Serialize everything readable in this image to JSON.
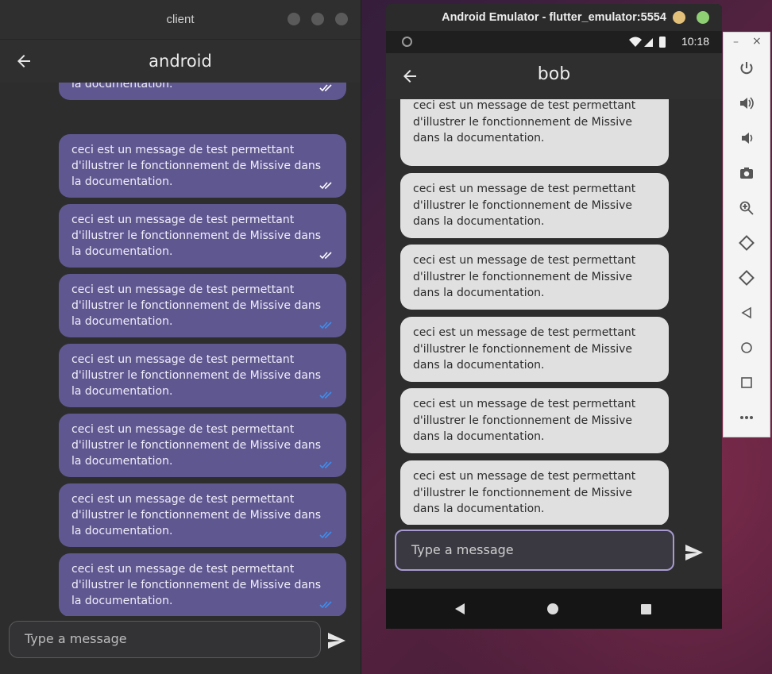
{
  "left_window": {
    "title": "client",
    "appbar_title": "android",
    "messages": [
      {
        "text": "d'illustrer le fonctionnement de Missive dans la documentation.",
        "status": "read"
      },
      {
        "text": "ceci est un message de test permettant d'illustrer le fonctionnement de Missive dans la documentation.",
        "status": "read"
      },
      {
        "text": "ceci est un message de test permettant d'illustrer le fonctionnement de Missive dans la documentation.",
        "status": "read"
      },
      {
        "text": "ceci est un message de test permettant d'illustrer le fonctionnement de Missive dans la documentation.",
        "status": "delivered"
      },
      {
        "text": "ceci est un message de test permettant d'illustrer le fonctionnement de Missive dans la documentation.",
        "status": "delivered"
      },
      {
        "text": "ceci est un message de test permettant d'illustrer le fonctionnement de Missive dans la documentation.",
        "status": "delivered"
      },
      {
        "text": "ceci est un message de test permettant d'illustrer le fonctionnement de Missive dans la documentation.",
        "status": "delivered"
      },
      {
        "text": "ceci est un message de test permettant d'illustrer le fonctionnement de Missive dans la documentation.",
        "status": "delivered"
      }
    ],
    "input_placeholder": "Type a message"
  },
  "emulator": {
    "window_title": "Android Emulator - flutter_emulator:5554",
    "status_time": "10:18",
    "appbar_title": "bob",
    "messages": [
      {
        "text": "ceci est un message de test permettant d'illustrer le fonctionnement de Missive dans la documentation."
      },
      {
        "text": "ceci est un message de test permettant d'illustrer le fonctionnement de Missive dans la documentation."
      },
      {
        "text": "ceci est un message de test permettant d'illustrer le fonctionnement de Missive dans la documentation."
      },
      {
        "text": "ceci est un message de test permettant d'illustrer le fonctionnement de Missive dans la documentation."
      },
      {
        "text": "ceci est un message de test permettant d'illustrer le fonctionnement de Missive dans la documentation."
      },
      {
        "text": "ceci est un message de test permettant d'illustrer le fonctionnement de Missive dans la documentation."
      }
    ],
    "input_placeholder": "Type a message",
    "colors": {
      "accent": "#a79ad0",
      "bubble_sent": "#5f5790",
      "bubble_received": "#e0e0e0",
      "tick_read": "#ffffff",
      "tick_delivered": "#3b8ff0"
    }
  },
  "toolbar": {
    "minimize": "–",
    "close": "×",
    "items": [
      "power-icon",
      "volume-up-icon",
      "volume-down-icon",
      "camera-icon",
      "zoom-icon",
      "rotate-left-icon",
      "rotate-right-icon",
      "back-icon",
      "home-icon",
      "overview-icon",
      "more-icon"
    ]
  }
}
